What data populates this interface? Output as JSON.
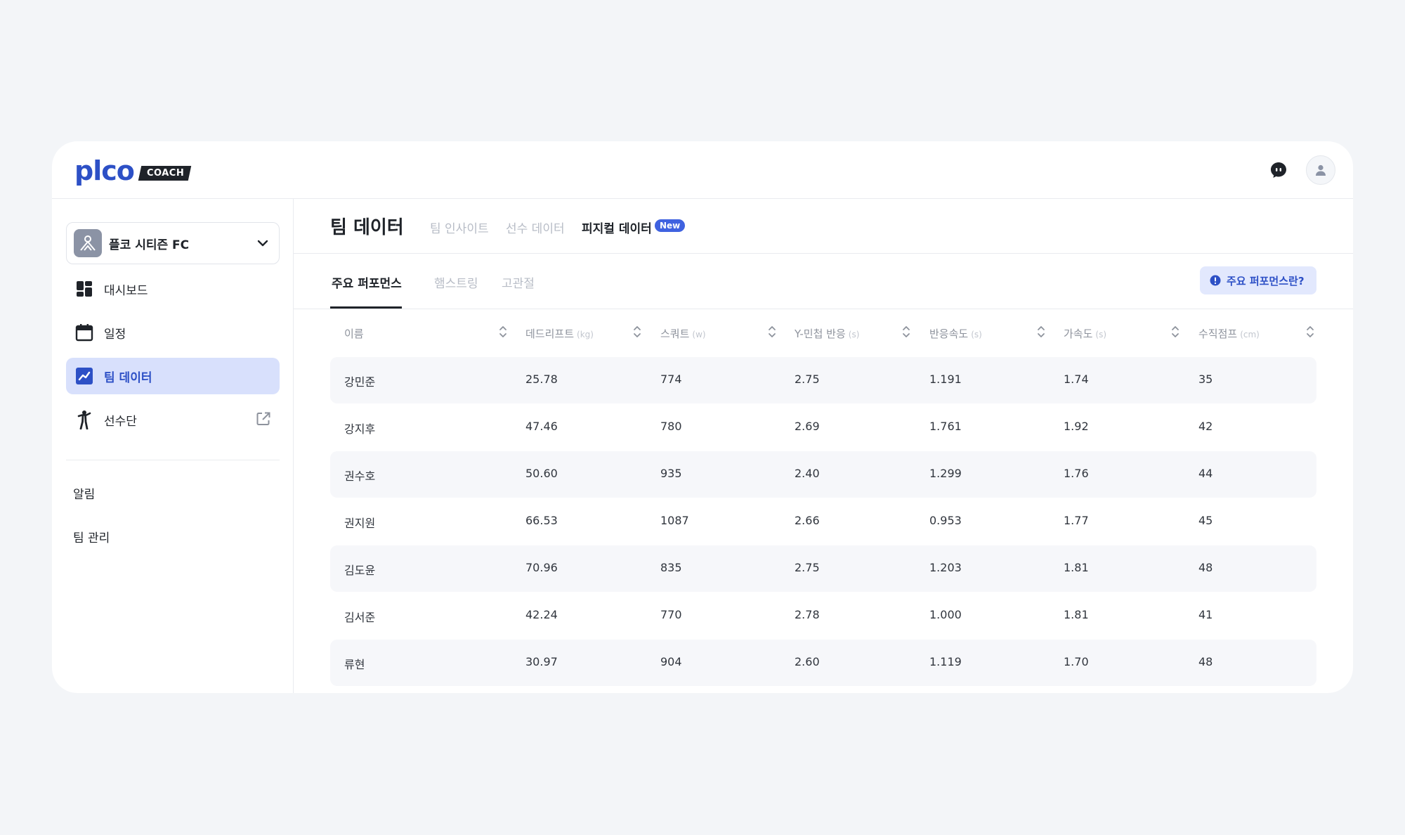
{
  "brand": {
    "logo_word": "plco",
    "logo_badge": "COACH"
  },
  "sidebar": {
    "team_name": "플코 시티즌 FC",
    "nav_items": [
      {
        "label": "대시보드",
        "icon": "dashboard-icon"
      },
      {
        "label": "일정",
        "icon": "calendar-icon"
      },
      {
        "label": "팀 데이터",
        "icon": "chart-icon",
        "active": true
      },
      {
        "label": "선수단",
        "icon": "player-icon",
        "external": true
      }
    ],
    "links": [
      {
        "label": "알림"
      },
      {
        "label": "팀 관리"
      }
    ]
  },
  "page": {
    "title": "팀 데이터",
    "tabs": [
      {
        "label": "팀 인사이트"
      },
      {
        "label": "선수 데이터"
      },
      {
        "label": "피지컬 데이터",
        "active": true,
        "badge": "New"
      }
    ],
    "sub_tabs": [
      {
        "label": "주요 퍼포먼스",
        "active": true
      },
      {
        "label": "햄스트링"
      },
      {
        "label": "고관절"
      }
    ],
    "info_button": "주요 퍼포먼스란?"
  },
  "table": {
    "columns": [
      {
        "label": "이름",
        "unit": ""
      },
      {
        "label": "데드리프트",
        "unit": "(kg)"
      },
      {
        "label": "스쿼트",
        "unit": "(w)"
      },
      {
        "label": "Y-민첩 반응",
        "unit": "(s)"
      },
      {
        "label": "반응속도",
        "unit": "(s)"
      },
      {
        "label": "가속도",
        "unit": "(s)"
      },
      {
        "label": "수직점프",
        "unit": "(cm)"
      }
    ],
    "rows": [
      [
        "강민준",
        "25.78",
        "774",
        "2.75",
        "1.191",
        "1.74",
        "35"
      ],
      [
        "강지후",
        "47.46",
        "780",
        "2.69",
        "1.761",
        "1.92",
        "42"
      ],
      [
        "권수호",
        "50.60",
        "935",
        "2.40",
        "1.299",
        "1.76",
        "44"
      ],
      [
        "권지원",
        "66.53",
        "1087",
        "2.66",
        "0.953",
        "1.77",
        "45"
      ],
      [
        "김도윤",
        "70.96",
        "835",
        "2.75",
        "1.203",
        "1.81",
        "48"
      ],
      [
        "김서준",
        "42.24",
        "770",
        "2.78",
        "1.000",
        "1.81",
        "41"
      ],
      [
        "류현",
        "30.97",
        "904",
        "2.60",
        "1.119",
        "1.70",
        "48"
      ]
    ]
  },
  "colors": {
    "accent": "#2d50c6",
    "active_bg": "#d8e0fc",
    "badge": "#3f62e0"
  }
}
